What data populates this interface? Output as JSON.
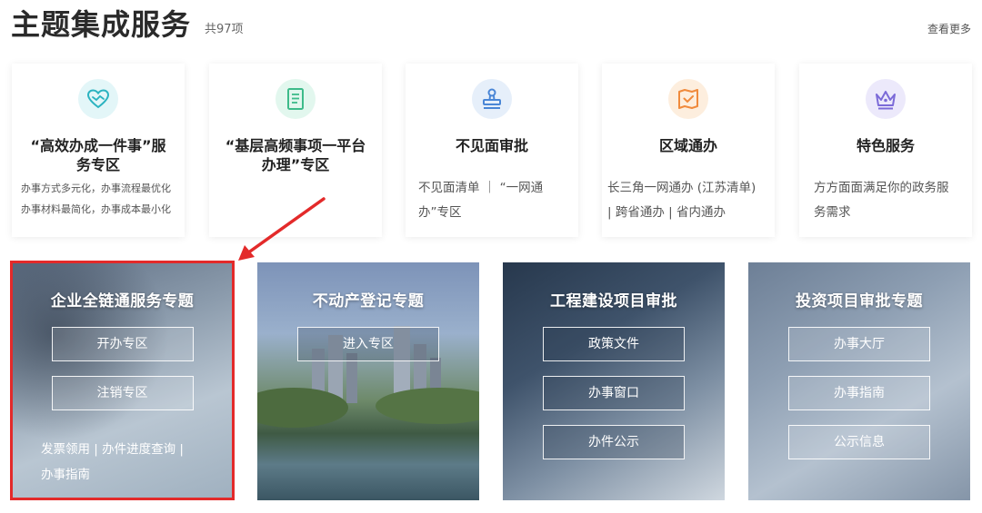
{
  "header": {
    "title": "主题集成服务",
    "count": "共97项",
    "more": "查看更多"
  },
  "cards": [
    {
      "icon": "handshake-heart-icon",
      "title": "“高效办成一件事”服务专区",
      "desc_lines": [
        "办事方式多元化，办事流程最优化",
        "办事材料最简化，办事成本最小化"
      ]
    },
    {
      "icon": "document-list-icon",
      "title": "“基层高频事项一平台办理”专区",
      "desc_lines": []
    },
    {
      "icon": "stamp-icon",
      "title": "不见面审批",
      "desc_lines": [
        "不见面清单 ｜ “一网通",
        "办”专区"
      ]
    },
    {
      "icon": "map-check-icon",
      "title": "区域通办",
      "desc_lines": [
        "长三角一网通办 (江苏清单)",
        "| 跨省通办 | 省内通办"
      ]
    },
    {
      "icon": "crown-icon",
      "title": "特色服务",
      "desc_lines": [
        "方方面面满足你的政务服",
        "务需求"
      ]
    }
  ],
  "panels": [
    {
      "title": "企业全链通服务专题",
      "buttons": [
        "开办专区",
        "注销专区"
      ],
      "links": [
        "发票领用 | 办件进度查询 |",
        "办事指南"
      ]
    },
    {
      "title": "不动产登记专题",
      "buttons": [
        "进入专区"
      ],
      "links": []
    },
    {
      "title": "工程建设项目审批",
      "buttons": [
        "政策文件",
        "办事窗口",
        "办件公示"
      ],
      "links": []
    },
    {
      "title": "投资项目审批专题",
      "buttons": [
        "办事大厅",
        "办事指南",
        "公示信息"
      ],
      "links": []
    }
  ],
  "colors": {
    "highlight": "#e32a2a",
    "arrow": "#e32a2a"
  }
}
